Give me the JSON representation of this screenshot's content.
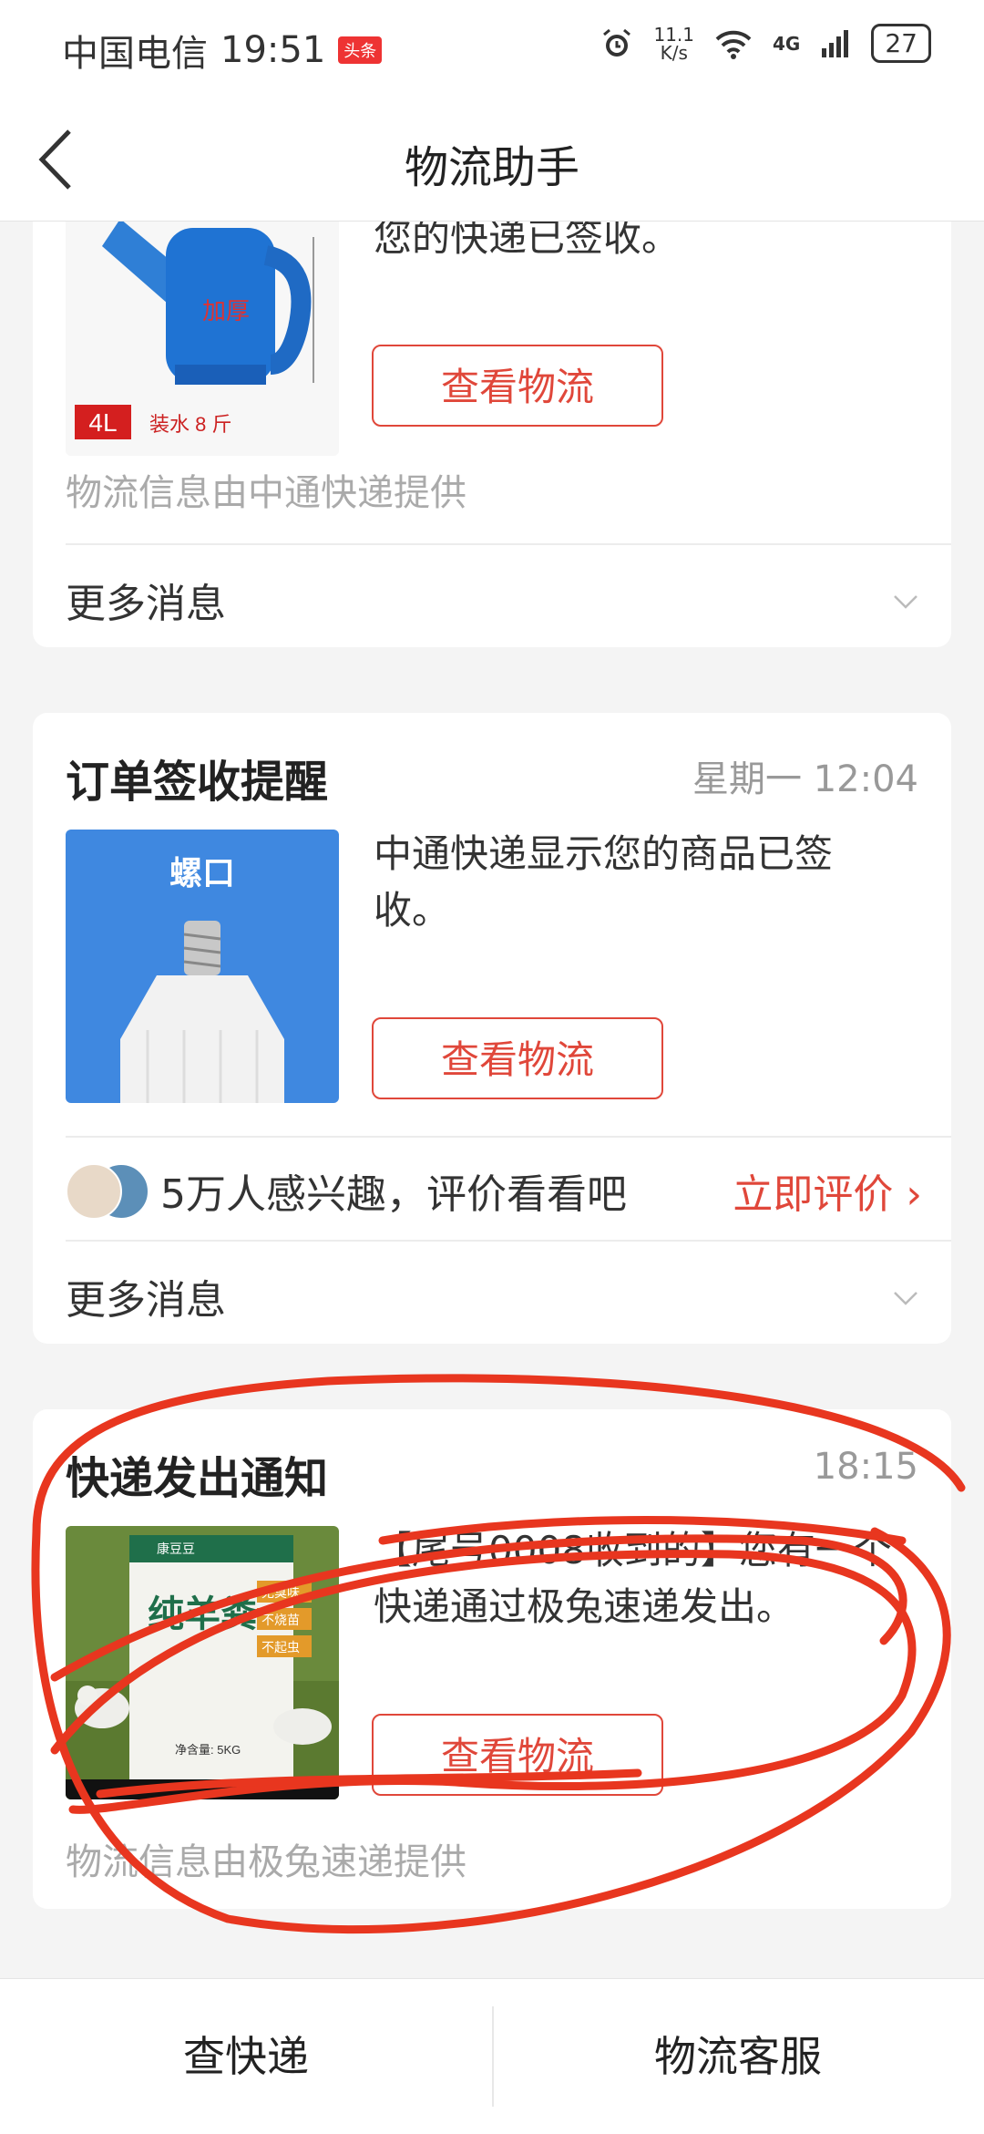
{
  "status_bar": {
    "carrier": "中国电信",
    "time": "19:51",
    "app_badge": "头条",
    "net_speed_value": "11.1",
    "net_speed_unit": "K/s",
    "signal_label": "4G",
    "battery": "27"
  },
  "header": {
    "title": "物流助手",
    "back_icon": "chevron-left-icon"
  },
  "cards": [
    {
      "message": "您的快递已签收。",
      "button_label": "查看物流",
      "provider_text": "物流信息由中通快递提供",
      "more_label": "更多消息",
      "thumb": {
        "size_badge": "4L",
        "caption": "装水 8 斤",
        "overlay_text": "加厚"
      }
    },
    {
      "title": "订单签收提醒",
      "time": "星期一 12:04",
      "message": "中通快递显示您的商品已签收。",
      "button_label": "查看物流",
      "interest_text": "5万人感兴趣，评价看看吧",
      "rate_label": "立即评价 ›",
      "more_label": "更多消息",
      "thumb": {
        "overlay_text": "螺口"
      }
    },
    {
      "title": "快递发出通知",
      "time": "18:15",
      "message": "【尾号0008收到的】您有一个快递通过极兔速递发出。",
      "button_label": "查看物流",
      "provider_text": "物流信息由极兔速递提供",
      "thumb": {
        "product_name": "纯羊粪",
        "brand": "康豆豆",
        "tag1": "无臭味",
        "tag2": "不烧苗",
        "tag3": "不起虫",
        "net_weight": "净含量: 5KG"
      }
    }
  ],
  "bottom_tabs": [
    {
      "label": "查快递"
    },
    {
      "label": "物流客服"
    }
  ],
  "colors": {
    "accent": "#e0473a",
    "background": "#f4f4f4",
    "annotation_red": "#e8361f"
  }
}
